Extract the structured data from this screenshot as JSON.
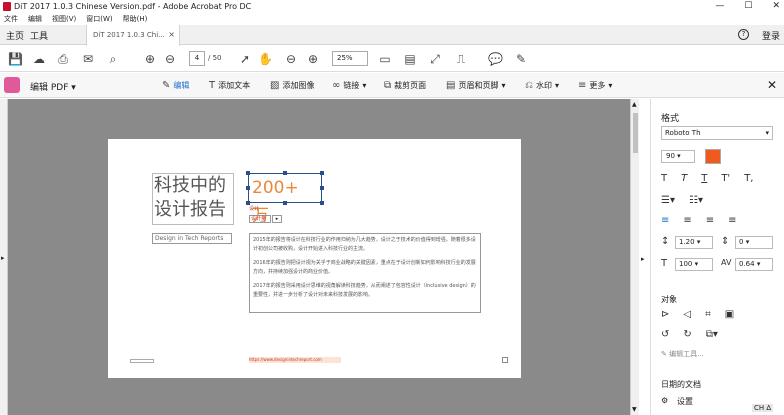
{
  "window": {
    "title": "DiT 2017 1.0.3 Chinese Version.pdf - Adobe Acrobat Pro DC",
    "controls": [
      "—",
      "☐",
      "✕"
    ]
  },
  "menu": [
    "文件",
    "编辑",
    "视图(V)",
    "窗口(W)",
    "帮助(H)"
  ],
  "tabs": {
    "home": "主页",
    "tools": "工具",
    "doc": "DiT 2017 1.0.3 Chi...",
    "doc_close": "×",
    "help": "?",
    "login": "登录"
  },
  "toolbar": {
    "page_current": "4",
    "page_total": "/ 50",
    "zoom": "25%"
  },
  "edit_toolbar": {
    "label": "编辑 PDF",
    "items": [
      {
        "label": "编辑",
        "icon": "edit-icon"
      },
      {
        "label": "添加文本",
        "icon": "text-icon"
      },
      {
        "label": "添加图像",
        "icon": "image-icon"
      },
      {
        "label": "链接",
        "icon": "link-icon"
      },
      {
        "label": "裁剪页面",
        "icon": "crop-icon"
      },
      {
        "label": "页眉和页脚",
        "icon": "header-footer-icon"
      },
      {
        "label": "水印",
        "icon": "watermark-icon"
      },
      {
        "label": "更多",
        "icon": "more-icon"
      }
    ]
  },
  "doc": {
    "title_line1": "科技中的",
    "title_line2": "设计报告",
    "stat": "200+ 万",
    "subtitle": "Design in Tech Reports",
    "design_label": "设计",
    "tag": "设计量",
    "tag_btn": "▸",
    "para1": "2015年的报告将设计在科技行业的作用归纳为几大趋势，设计之于技术的价值得到增强，随着很多设计初创公司被收购，设计开始进入科技行业的主流。",
    "para2": "2016年的报告则把设计视为关乎于商业战略的关键因素，重点在于设计创新如何影响科技行业的发展方向，并持续加强设计的商业价值。",
    "para3": "2017年的报告则采用设计思维的视角解读科技趋势，从而阐述了包容性设计（inclusive design）的重要性，并进一步分析了设计对未来科技发展的影响。",
    "link": "https://www.designintechreport.com"
  },
  "panel": {
    "title": "格式",
    "font": "Roboto Th",
    "size": "90",
    "color": "#f15a1d",
    "line_spacing": "1.20",
    "para_spacing": "0",
    "scale": "100",
    "char_spacing": "0.64",
    "objects_label": "对象",
    "edit_image": "编辑工具...",
    "dates_label": "日期的文档",
    "settings": "设置"
  },
  "ime": "CH ∆"
}
